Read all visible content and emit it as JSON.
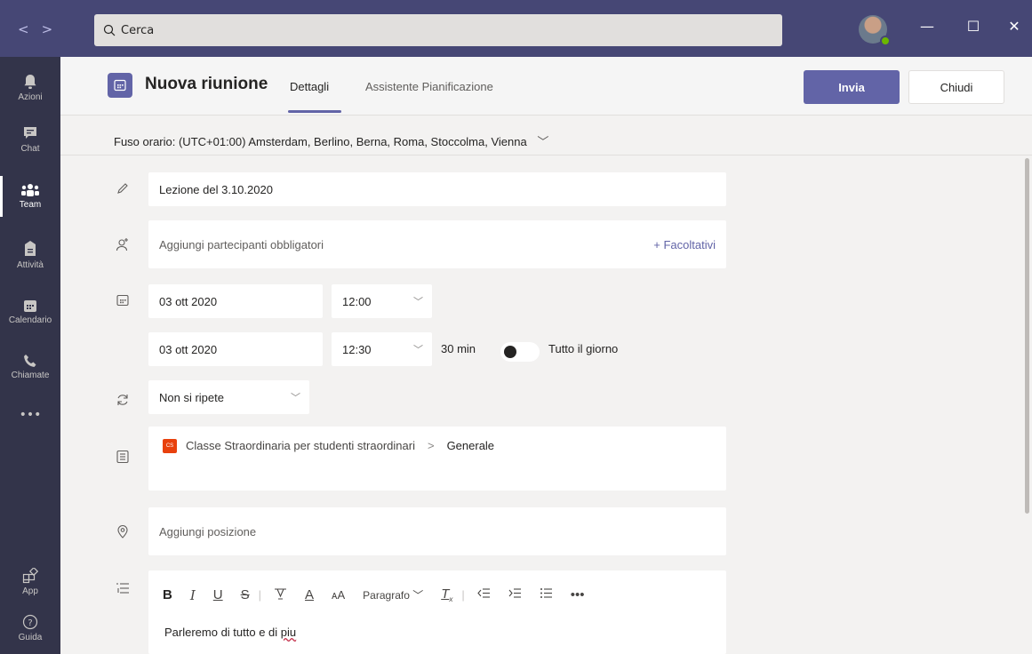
{
  "titlebar": {
    "search_placeholder": "Cerca",
    "minimize": "—",
    "maximize": "☐",
    "close": "✕"
  },
  "rail": {
    "items": [
      {
        "label": "Azioni",
        "icon": "bell-icon"
      },
      {
        "label": "Chat",
        "icon": "chat-icon"
      },
      {
        "label": "Team",
        "icon": "teams-icon"
      },
      {
        "label": "Attività",
        "icon": "assignments-icon"
      },
      {
        "label": "Calendario",
        "icon": "calendar-icon"
      },
      {
        "label": "Chiamate",
        "icon": "phone-icon"
      },
      {
        "label": "•••",
        "icon": "more-icon"
      }
    ],
    "bottom": [
      {
        "label": "App",
        "icon": "apps-icon"
      },
      {
        "label": "Guida",
        "icon": "help-icon"
      }
    ],
    "active": "Team"
  },
  "header": {
    "title": "Nuova riunione",
    "tabs": [
      "Dettagli",
      "Assistente Pianificazione"
    ],
    "send_label": "Invia",
    "close_label": "Chiudi"
  },
  "timezone": "Fuso orario: (UTC+01:00) Amsterdam, Berlino, Berna, Roma, Stoccolma, Vienna",
  "form": {
    "title_value": "Lezione del 3.10.2020",
    "attendees_placeholder": "Aggiungi partecipanti obbligatori",
    "optional_link": "+ Facoltativi",
    "start_date": "03 ott 2020",
    "start_time": "12:00",
    "end_date": "03 ott 2020",
    "end_time": "12:30",
    "duration": "30 min",
    "all_day_label": "Tutto il giorno",
    "all_day": false,
    "repeat": "Non si ripete",
    "channel_team": "Classe Straordinaria per studenti straordinari",
    "channel_badge": "CS",
    "channel_sep": ">",
    "channel_name": "Generale",
    "location_placeholder": "Aggiungi posizione"
  },
  "editor": {
    "paragraph_label": "Paragrafo",
    "body_prefix": "Parleremo di tutto e di ",
    "body_misspelled": "piu"
  },
  "colors": {
    "accent": "#6264a7",
    "titlebar": "#464775",
    "rail": "#33344a",
    "background": "#f3f2f1"
  }
}
